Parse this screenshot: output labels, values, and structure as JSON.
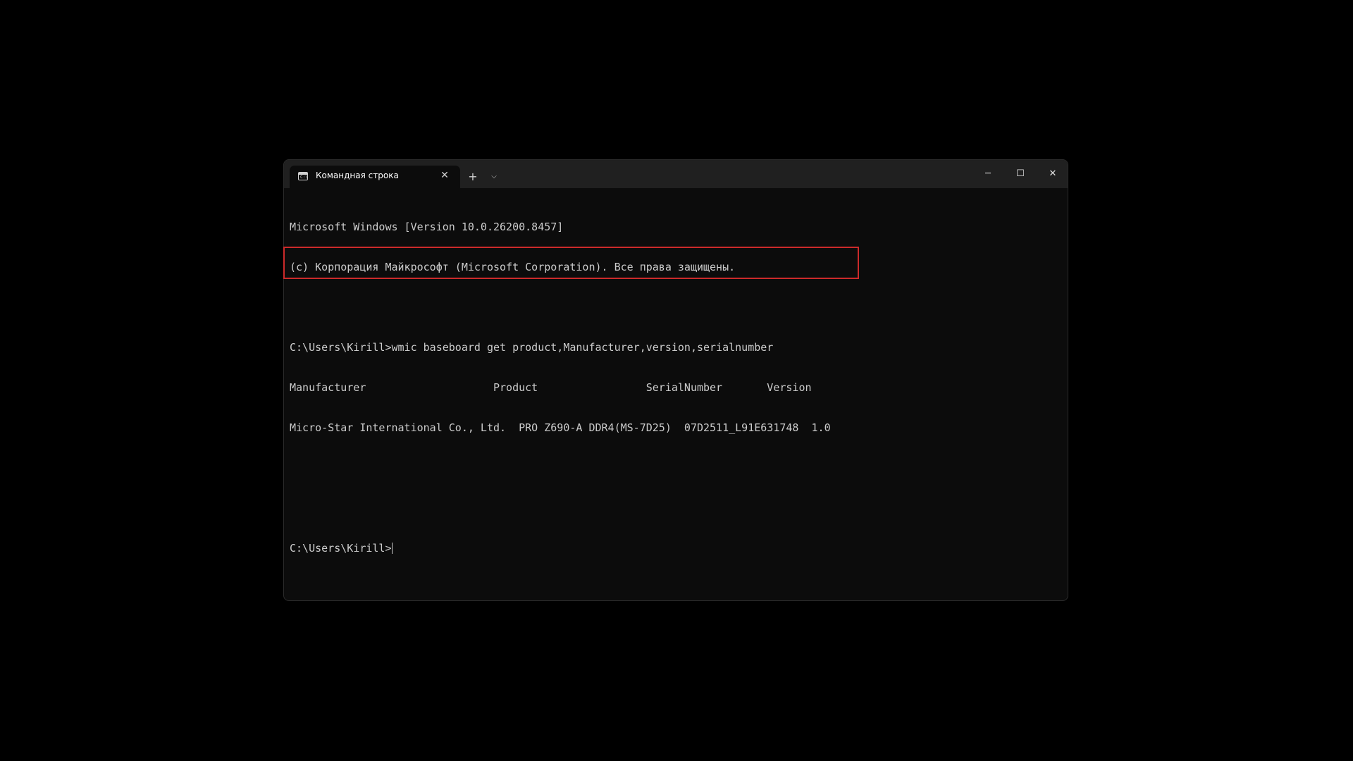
{
  "tab": {
    "icon": "terminal-icon",
    "title": "Командная строка",
    "close_glyph": "✕"
  },
  "tabbar": {
    "new_tab_glyph": "+",
    "dropdown_glyph": "⌵"
  },
  "window_controls": {
    "minimize_glyph": "─",
    "maximize_glyph": "☐",
    "close_glyph": "✕"
  },
  "console": {
    "line1": "Microsoft Windows [Version 10.0.26200.8457]",
    "line2": "(c) Корпорация Майкрософт (Microsoft Corporation). Все права защищены.",
    "command": "C:\\Users\\Kirill>wmic baseboard get product,Manufacturer,version,serialnumber",
    "header_row": "Manufacturer                    Product                 SerialNumber       Version",
    "value_row": "Micro-Star International Co., Ltd.  PRO Z690-A DDR4(MS-7D25)  07D2511_L91E631748  1.0",
    "prompt": "C:\\Users\\Kirill>"
  },
  "highlight_color": "#cc2a2a",
  "colors": {
    "background": "#000000",
    "console_bg": "#0c0c0c",
    "titlebar": "#202020",
    "text": "#cccccc"
  }
}
